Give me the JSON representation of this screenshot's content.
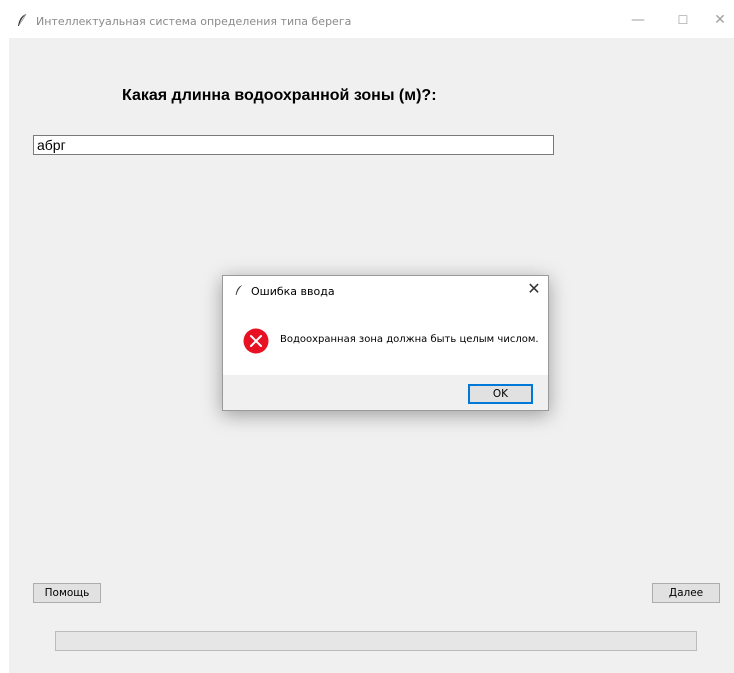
{
  "window": {
    "title": "Интеллектуальная система определения типа берега",
    "controls": {
      "minimize": "—",
      "maximize": "☐",
      "close": "✕"
    }
  },
  "form": {
    "question": "Какая длинна водоохранной зоны (м)?:",
    "answer_value": "абрг"
  },
  "buttons": {
    "help_label": "Помощь",
    "next_label": "Далее"
  },
  "progress": {
    "value": 0
  },
  "dialog": {
    "title": "Ошибка ввода",
    "close_glyph": "✕",
    "message": "Водоохранная зона должна быть целым числом.",
    "ok_label": "OK",
    "icon": "error-icon"
  },
  "colors": {
    "error_red": "#e81123",
    "focus_blue": "#0078d7",
    "client_bg": "#f0f0f0"
  }
}
